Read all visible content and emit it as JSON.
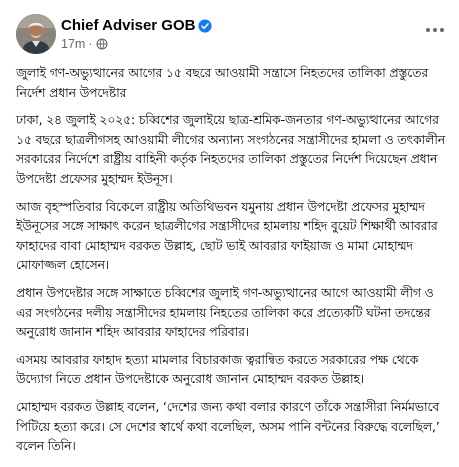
{
  "post": {
    "author": "Chief Adviser GOB",
    "timestamp": "17m",
    "icons": {
      "verified": "verified-badge-icon",
      "audience": "globe-icon",
      "more": "more-options-icon"
    },
    "colors": {
      "verified": "#1877f2",
      "meta": "#65676b",
      "text": "#050505"
    },
    "paragraphs": [
      "জুলাই গণ-অভ্যুত্থানের আগের ১৫ বছরে আওয়ামী সন্ত্রাসে নিহতদের তালিকা প্রস্তুতের নির্দেশ প্রধান উপদেষ্টার",
      "ঢাকা, ২৪ জুলাই ২০২৫: চব্বিশের জুলাইয়ে ছাত্র-শ্রমিক-জনতার গণ-অভ্যুত্থানের আগের ১৫ বছরে ছাত্রলীগসহ আওয়ামী লীগের অন্যান্য সংগঠনের সন্ত্রাসীদের হামলা ও তৎকালীন সরকারের নির্দেশে রাষ্ট্রীয় বাহিনী কর্তৃক নিহতদের তালিকা প্রস্তুতের নির্দেশ দিয়েছেন প্রধান উপদেষ্টা প্রফেসর মুহাম্মদ ইউনূস।",
      "আজ বৃহস্পতিবার বিকেলে রাষ্ট্রীয় অতিথিভবন যমুনায় প্রধান উপদেষ্টা প্রফেসর মুহাম্মদ ইউনূসের সঙ্গে সাক্ষাৎ করেন ছাত্রলীগের সন্ত্রাসীদের হামলায় শহিদ বুয়েট শিক্ষার্থী আবরার ফাহাদের বাবা মোহাম্মদ বরকত উল্লাহ, ছোট ভাই আবরার ফাইয়াজ ও মামা মোহাম্মদ মোফাজ্জল হোসেন।",
      "প্রধান উপদেষ্টার সঙ্গে সাক্ষাতে চব্বিশের জুলাই গণ-অভ্যুত্থানের আগে আওয়ামী লীগ ও এর সংগঠনের দলীয় সন্ত্রাসীদের হামলায় নিহতের তালিকা করে প্রত্যেকটি ঘটনা তদন্তের অনুরোধ জানান শহিদ আবরার ফাহাদের পরিবার।",
      "এসময় আবরার ফাহাদ হত্যা মামলার বিচারকাজ ত্বরান্বিত করতে সরকারের পক্ষ থেকে উদ্যোগ নিতে প্রধান উপদেষ্টাকে অনুরোধ জানান মোহাম্মদ বরকত উল্লাহ।",
      "মোহাম্মদ বরকত উল্লাহ বলেন, ‘দেশের জন্য কথা বলার কারণে তাঁকে সন্ত্রাসীরা নির্মমভাবে পিটিয়ে হত্যা করে। সে দেশের স্বার্থে কথা বলেছিল, অসম পানি বন্টনের বিরুদ্ধে বলেছিল,’ বলেন তিনি।"
    ]
  }
}
